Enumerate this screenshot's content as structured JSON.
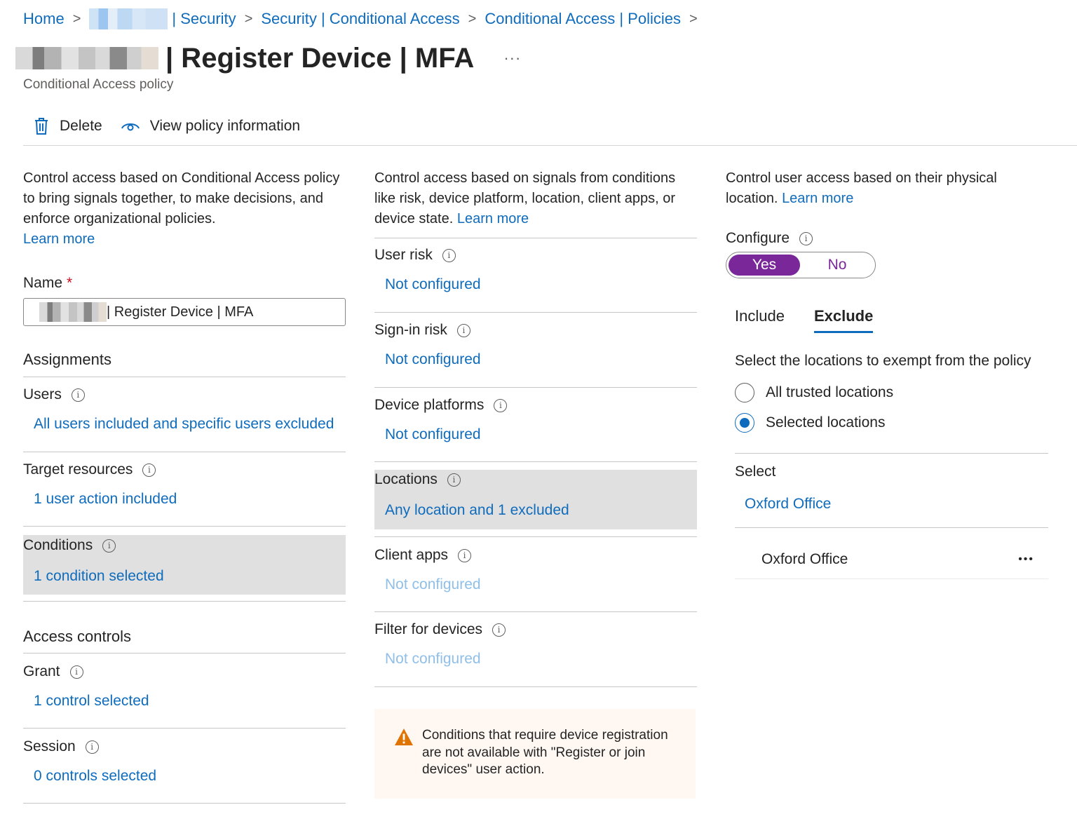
{
  "breadcrumb": {
    "home": "Home",
    "tenant_suffix": "| Security",
    "item2": "Security | Conditional Access",
    "item3": "Conditional Access | Policies",
    "separator": ">"
  },
  "page": {
    "title": "| Register Device | MFA",
    "more": "···",
    "subtitle": "Conditional Access policy"
  },
  "toolbar": {
    "delete_label": "Delete",
    "view_policy_label": "View policy information"
  },
  "left": {
    "description": "Control access based on Conditional Access policy to bring signals together, to make decisions, and enforce organizational policies.",
    "learn_more": "Learn more",
    "name_label": "Name",
    "required_mark": "*",
    "name_value": "| Register Device | MFA",
    "assignments_heading": "Assignments",
    "users_label": "Users",
    "users_value": "All users included and specific users excluded",
    "target_label": "Target resources",
    "target_value": "1 user action included",
    "conditions_label": "Conditions",
    "conditions_value": "1 condition selected",
    "access_heading": "Access controls",
    "grant_label": "Grant",
    "grant_value": "1 control selected",
    "session_label": "Session",
    "session_value": "0 controls selected"
  },
  "middle": {
    "description": "Control access based on signals from conditions like risk, device platform, location, client apps, or device state.",
    "learn_more": "Learn more",
    "user_risk_label": "User risk",
    "user_risk_value": "Not configured",
    "signin_risk_label": "Sign-in risk",
    "signin_risk_value": "Not configured",
    "device_platforms_label": "Device platforms",
    "device_platforms_value": "Not configured",
    "locations_label": "Locations",
    "locations_value": "Any location and 1 excluded",
    "client_apps_label": "Client apps",
    "client_apps_value": "Not configured",
    "filter_label": "Filter for devices",
    "filter_value": "Not configured",
    "warning_text": "Conditions that require device registration are not available with \"Register or join devices\" user action."
  },
  "right": {
    "description": "Control user access based on their physical location.",
    "learn_more": "Learn more",
    "configure_label": "Configure",
    "toggle_yes": "Yes",
    "toggle_no": "No",
    "tab_include": "Include",
    "tab_exclude": "Exclude",
    "exempt_text": "Select the locations to exempt from the policy",
    "radio_all": "All trusted locations",
    "radio_selected": "Selected locations",
    "select_label": "Select",
    "select_value": "Oxford Office",
    "location_item": "Oxford Office",
    "item_more": "•••"
  },
  "colors": {
    "link": "#0f6cbd",
    "toggle_accent": "#7a2899",
    "selected_bg": "#e0e0e0",
    "warning_icon": "#e07400"
  }
}
